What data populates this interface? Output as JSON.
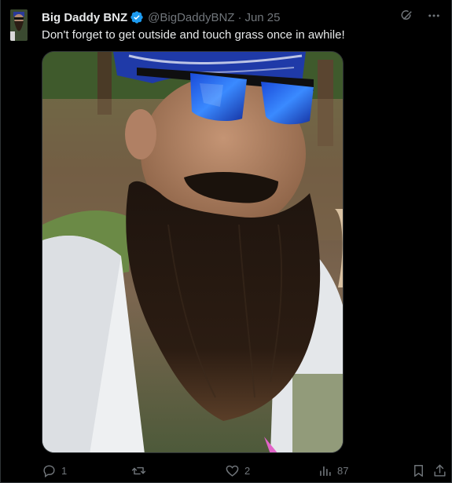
{
  "post": {
    "display_name": "Big Daddy BNZ",
    "handle": "@BigDaddyBNZ",
    "separator": "·",
    "date": "Jun 25",
    "text": "Don't forget to get outside and touch grass once in awhile!",
    "verified": true
  },
  "icons": {
    "grok": "grok-icon",
    "more": "more-icon",
    "verified": "verified-badge-icon",
    "reply": "reply-icon",
    "repost": "repost-icon",
    "like": "like-icon",
    "views": "views-icon",
    "bookmark": "bookmark-icon",
    "share": "share-icon"
  },
  "metrics": {
    "replies": "1",
    "reposts": "",
    "likes": "2",
    "views": "87"
  },
  "colors": {
    "background": "#000000",
    "text_primary": "#e7e9ea",
    "text_secondary": "#71767b",
    "verified_blue": "#1d9bf0",
    "border": "#2f3336"
  }
}
